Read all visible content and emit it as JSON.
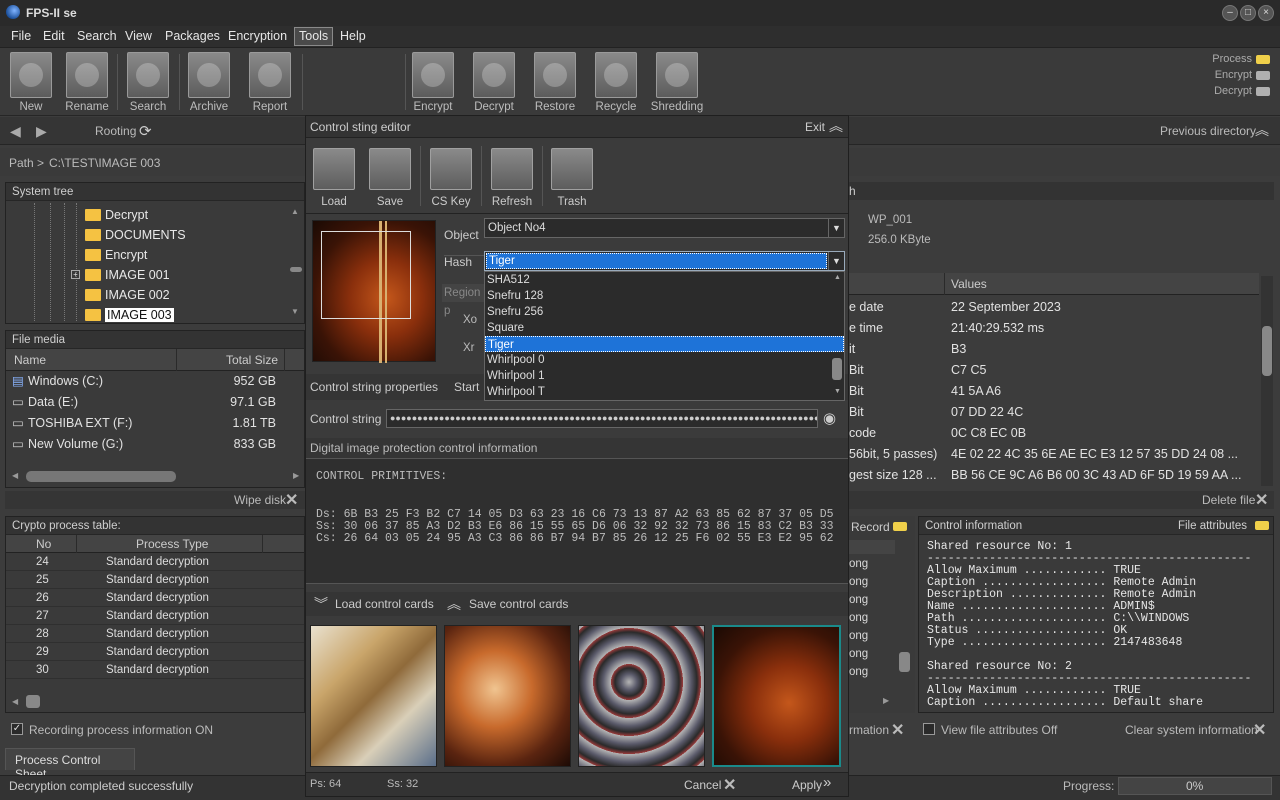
{
  "app": {
    "title": "FPS-II se"
  },
  "menu": [
    "File",
    "Edit",
    "Search",
    "View",
    "Packages",
    "Encryption",
    "Tools",
    "Help"
  ],
  "toolbar": {
    "buttons": [
      "New",
      "Rename",
      "Search",
      "Archive",
      "Report",
      "Encrypt",
      "Decrypt",
      "Restore",
      "Recycle",
      "Shredding"
    ]
  },
  "status_indicators": [
    "Process",
    "Encrypt",
    "Decrypt"
  ],
  "colors": {
    "accent": "#1e73d8",
    "led_yellow": "#f0d04a",
    "led_gray": "#b0b0b0",
    "thumb_selected": "#1a8a8a"
  },
  "nav": {
    "rooting": "Rooting",
    "previous": "Previous directory"
  },
  "path": {
    "label": "Path >",
    "value": "C:\\TEST\\IMAGE 003"
  },
  "system_tree": {
    "title": "System tree",
    "items": [
      "Decrypt",
      "DOCUMENTS",
      "Encrypt",
      "IMAGE 001",
      "IMAGE 002",
      "IMAGE 003"
    ]
  },
  "file_media": {
    "title": "File media",
    "col_name": "Name",
    "col_size": "Total Size",
    "rows": [
      {
        "name": "Windows  (C:)",
        "size": "952 GB"
      },
      {
        "name": "Data (E:)",
        "size": "97.1 GB"
      },
      {
        "name": "TOSHIBA EXT (F:)",
        "size": "1.81 TB"
      },
      {
        "name": "New Volume (G:)",
        "size": "833 GB"
      }
    ],
    "wipe": "Wipe disk"
  },
  "crypto": {
    "title": "Crypto process table:",
    "col_no": "No",
    "col_type": "Process Type",
    "rows": [
      {
        "no": "24",
        "type": "Standard decryption"
      },
      {
        "no": "25",
        "type": "Standard decryption"
      },
      {
        "no": "26",
        "type": "Standard decryption"
      },
      {
        "no": "27",
        "type": "Standard decryption"
      },
      {
        "no": "28",
        "type": "Standard decryption"
      },
      {
        "no": "29",
        "type": "Standard decryption"
      },
      {
        "no": "30",
        "type": "Standard decryption"
      }
    ],
    "right_suffix": "ong",
    "recording": "Recording process information ON"
  },
  "right_info": {
    "h": "h",
    "file": "WP_001",
    "size": "256.0 KByte",
    "values_header": "Values",
    "delete": "Delete file",
    "rows": [
      {
        "k": "e date",
        "v": "22 September 2023"
      },
      {
        "k": "e time",
        "v": "21:40:29.532 ms"
      },
      {
        "k": "it",
        "v": "B3"
      },
      {
        "k": "Bit",
        "v": "C7 C5"
      },
      {
        "k": "Bit",
        "v": "41 5A A6"
      },
      {
        "k": "Bit",
        "v": "07 DD 22 4C"
      },
      {
        "k": "code",
        "v": "0C C8 EC 0B"
      },
      {
        "k": "56bit, 5 passes)",
        "v": "4E 02 22 4C 35 6E AE EC E3 12 57 35 DD 24 08 ..."
      },
      {
        "k": "gest size 128 ...",
        "v": "BB 56 CE 9C A6 B6 00 3C 43 AD 6F 5D 19 59 AA ..."
      }
    ]
  },
  "control_info": {
    "title": "Control information",
    "attrs": "File attributes",
    "record": "Record",
    "rmation": "rmation",
    "text": "Shared resource No: 1\n-----------------------------------------------\nAllow Maximum ............ TRUE\nCaption .................. Remote Admin\nDescription .............. Remote Admin\nName ..................... ADMIN$\nPath ..................... C:\\\\WINDOWS\nStatus ................... OK\nType ..................... 2147483648\n\nShared resource No: 2\n-----------------------------------------------\nAllow Maximum ............ TRUE\nCaption .................. Default share",
    "view_attrs": "View file attributes Off",
    "clear": "Clear system information"
  },
  "dialog": {
    "title": "Control sting editor",
    "exit": "Exit",
    "buttons": [
      "Load",
      "Save",
      "CS Key",
      "Refresh",
      "Trash"
    ],
    "object_label": "Object",
    "object_value": "Object No4",
    "hash_label": "Hash",
    "hash_value": "Tiger",
    "region": "Region p",
    "xo": "Xo",
    "xr": "Xr",
    "hash_options": [
      "SHA512",
      "Snefru 128",
      "Snefru 256",
      "Square",
      "Tiger",
      "Whirlpool 0",
      "Whirlpool 1",
      "Whirlpool T"
    ],
    "props": "Control string properties",
    "start": "Start",
    "cs_label": "Control string",
    "cs_value": "●●●●●●●●●●●●●●●●●●●●●●●●●●●●●●●●●●●●●●●●●●●●●●●●●●●●●●●●●●●●●●●●●●●●●●●●●●●●●●●",
    "dip_title": "Digital image protection control information",
    "primitives": "CONTROL PRIMITIVES:",
    "ds": "Ds: 6B B3 25 F3 B2 C7 14 05 D3 63 23 16 C6 73 13 87 A2 63 85 62 87 37 05 D5",
    "ss": "Ss: 30 06 37 85 A3 D2 B3 E6 86 15 55 65 D6 06 32 92 32 73 86 15 83 C2 B3 33",
    "cs": "Cs: 26 64 03 05 24 95 A3 C3 86 86 B7 94 B7 85 26 12 25 F6 02 55 E3 E2 95 62",
    "load_cards": "Load control cards",
    "save_cards": "Save control cards",
    "ps": "Ps: 64",
    "ss_count": "Ss: 32",
    "cancel": "Cancel",
    "apply": "Apply"
  },
  "tabs": {
    "sheet": "Process Control Sheet"
  },
  "status": {
    "message": "Decryption completed successfully",
    "progress_label": "Progress:",
    "progress_value": "0%"
  }
}
